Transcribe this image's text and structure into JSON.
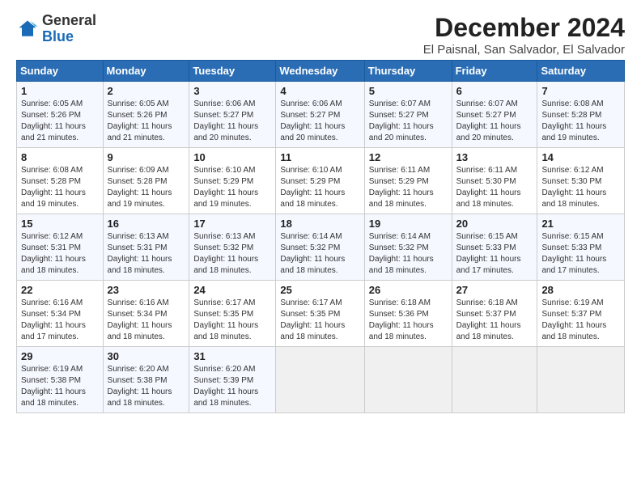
{
  "logo": {
    "general": "General",
    "blue": "Blue"
  },
  "title": "December 2024",
  "location": "El Paisnal, San Salvador, El Salvador",
  "days_of_week": [
    "Sunday",
    "Monday",
    "Tuesday",
    "Wednesday",
    "Thursday",
    "Friday",
    "Saturday"
  ],
  "weeks": [
    [
      {
        "day": "1",
        "info": "Sunrise: 6:05 AM\nSunset: 5:26 PM\nDaylight: 11 hours\nand 21 minutes."
      },
      {
        "day": "2",
        "info": "Sunrise: 6:05 AM\nSunset: 5:26 PM\nDaylight: 11 hours\nand 21 minutes."
      },
      {
        "day": "3",
        "info": "Sunrise: 6:06 AM\nSunset: 5:27 PM\nDaylight: 11 hours\nand 20 minutes."
      },
      {
        "day": "4",
        "info": "Sunrise: 6:06 AM\nSunset: 5:27 PM\nDaylight: 11 hours\nand 20 minutes."
      },
      {
        "day": "5",
        "info": "Sunrise: 6:07 AM\nSunset: 5:27 PM\nDaylight: 11 hours\nand 20 minutes."
      },
      {
        "day": "6",
        "info": "Sunrise: 6:07 AM\nSunset: 5:27 PM\nDaylight: 11 hours\nand 20 minutes."
      },
      {
        "day": "7",
        "info": "Sunrise: 6:08 AM\nSunset: 5:28 PM\nDaylight: 11 hours\nand 19 minutes."
      }
    ],
    [
      {
        "day": "8",
        "info": "Sunrise: 6:08 AM\nSunset: 5:28 PM\nDaylight: 11 hours\nand 19 minutes."
      },
      {
        "day": "9",
        "info": "Sunrise: 6:09 AM\nSunset: 5:28 PM\nDaylight: 11 hours\nand 19 minutes."
      },
      {
        "day": "10",
        "info": "Sunrise: 6:10 AM\nSunset: 5:29 PM\nDaylight: 11 hours\nand 19 minutes."
      },
      {
        "day": "11",
        "info": "Sunrise: 6:10 AM\nSunset: 5:29 PM\nDaylight: 11 hours\nand 18 minutes."
      },
      {
        "day": "12",
        "info": "Sunrise: 6:11 AM\nSunset: 5:29 PM\nDaylight: 11 hours\nand 18 minutes."
      },
      {
        "day": "13",
        "info": "Sunrise: 6:11 AM\nSunset: 5:30 PM\nDaylight: 11 hours\nand 18 minutes."
      },
      {
        "day": "14",
        "info": "Sunrise: 6:12 AM\nSunset: 5:30 PM\nDaylight: 11 hours\nand 18 minutes."
      }
    ],
    [
      {
        "day": "15",
        "info": "Sunrise: 6:12 AM\nSunset: 5:31 PM\nDaylight: 11 hours\nand 18 minutes."
      },
      {
        "day": "16",
        "info": "Sunrise: 6:13 AM\nSunset: 5:31 PM\nDaylight: 11 hours\nand 18 minutes."
      },
      {
        "day": "17",
        "info": "Sunrise: 6:13 AM\nSunset: 5:32 PM\nDaylight: 11 hours\nand 18 minutes."
      },
      {
        "day": "18",
        "info": "Sunrise: 6:14 AM\nSunset: 5:32 PM\nDaylight: 11 hours\nand 18 minutes."
      },
      {
        "day": "19",
        "info": "Sunrise: 6:14 AM\nSunset: 5:32 PM\nDaylight: 11 hours\nand 18 minutes."
      },
      {
        "day": "20",
        "info": "Sunrise: 6:15 AM\nSunset: 5:33 PM\nDaylight: 11 hours\nand 17 minutes."
      },
      {
        "day": "21",
        "info": "Sunrise: 6:15 AM\nSunset: 5:33 PM\nDaylight: 11 hours\nand 17 minutes."
      }
    ],
    [
      {
        "day": "22",
        "info": "Sunrise: 6:16 AM\nSunset: 5:34 PM\nDaylight: 11 hours\nand 17 minutes."
      },
      {
        "day": "23",
        "info": "Sunrise: 6:16 AM\nSunset: 5:34 PM\nDaylight: 11 hours\nand 18 minutes."
      },
      {
        "day": "24",
        "info": "Sunrise: 6:17 AM\nSunset: 5:35 PM\nDaylight: 11 hours\nand 18 minutes."
      },
      {
        "day": "25",
        "info": "Sunrise: 6:17 AM\nSunset: 5:35 PM\nDaylight: 11 hours\nand 18 minutes."
      },
      {
        "day": "26",
        "info": "Sunrise: 6:18 AM\nSunset: 5:36 PM\nDaylight: 11 hours\nand 18 minutes."
      },
      {
        "day": "27",
        "info": "Sunrise: 6:18 AM\nSunset: 5:37 PM\nDaylight: 11 hours\nand 18 minutes."
      },
      {
        "day": "28",
        "info": "Sunrise: 6:19 AM\nSunset: 5:37 PM\nDaylight: 11 hours\nand 18 minutes."
      }
    ],
    [
      {
        "day": "29",
        "info": "Sunrise: 6:19 AM\nSunset: 5:38 PM\nDaylight: 11 hours\nand 18 minutes."
      },
      {
        "day": "30",
        "info": "Sunrise: 6:20 AM\nSunset: 5:38 PM\nDaylight: 11 hours\nand 18 minutes."
      },
      {
        "day": "31",
        "info": "Sunrise: 6:20 AM\nSunset: 5:39 PM\nDaylight: 11 hours\nand 18 minutes."
      },
      {
        "day": "",
        "info": ""
      },
      {
        "day": "",
        "info": ""
      },
      {
        "day": "",
        "info": ""
      },
      {
        "day": "",
        "info": ""
      }
    ]
  ]
}
